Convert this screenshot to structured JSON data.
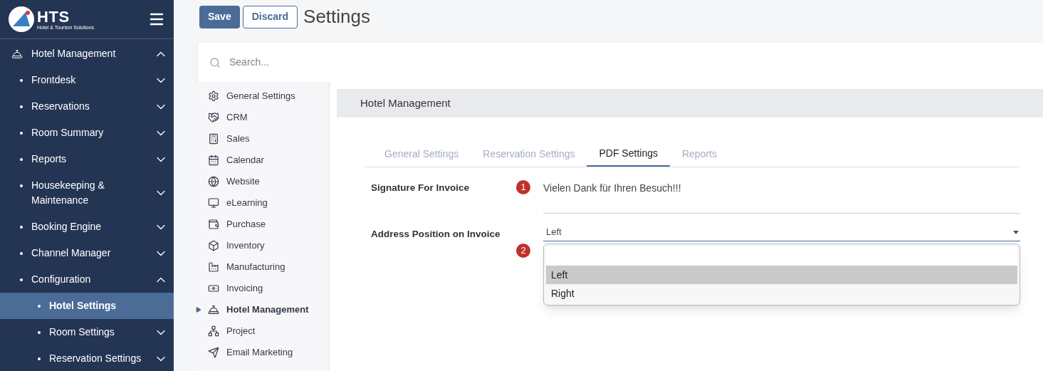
{
  "logo": {
    "name": "HTS",
    "subtitle": "Hotel & Tourism Solutions"
  },
  "sidebar": {
    "items": [
      {
        "label": "Hotel Management",
        "expanded": true,
        "selected": false,
        "children": [
          {
            "label": "Frontdesk",
            "expanded": false,
            "selected": false
          },
          {
            "label": "Reservations",
            "expanded": false,
            "selected": false
          },
          {
            "label": "Room Summary",
            "expanded": false,
            "selected": false
          },
          {
            "label": "Reports",
            "expanded": false,
            "selected": false
          },
          {
            "label": "Housekeeping & Maintenance",
            "expanded": false,
            "selected": false
          },
          {
            "label": "Booking Engine",
            "expanded": false,
            "selected": false
          },
          {
            "label": "Channel Manager",
            "expanded": false,
            "selected": false
          },
          {
            "label": "Configuration",
            "expanded": true,
            "selected": false,
            "children": [
              {
                "label": "Hotel Settings",
                "selected": true
              },
              {
                "label": "Room Settings",
                "expanded": false,
                "selected": false
              },
              {
                "label": "Reservation Settings",
                "expanded": false,
                "selected": false
              }
            ]
          }
        ]
      }
    ]
  },
  "toolbar": {
    "buttons": [
      "Save",
      "Discard"
    ],
    "title": "Settings"
  },
  "search": {
    "placeholder": "Search..."
  },
  "settings_nav": [
    {
      "label": "General Settings",
      "selected": false
    },
    {
      "label": "CRM",
      "selected": false
    },
    {
      "label": "Sales",
      "selected": false
    },
    {
      "label": "Calendar",
      "selected": false
    },
    {
      "label": "Website",
      "selected": false
    },
    {
      "label": "eLearning",
      "selected": false
    },
    {
      "label": "Purchase",
      "selected": false
    },
    {
      "label": "Inventory",
      "selected": false
    },
    {
      "label": "Manufacturing",
      "selected": false
    },
    {
      "label": "Invoicing",
      "selected": false
    },
    {
      "label": "Hotel Management",
      "selected": true
    },
    {
      "label": "Project",
      "selected": false
    },
    {
      "label": "Email Marketing",
      "selected": false
    }
  ],
  "panel": {
    "header": "Hotel Management",
    "tabs": [
      {
        "label": "General Settings",
        "selected": false
      },
      {
        "label": "Reservation Settings",
        "selected": false
      },
      {
        "label": "PDF Settings",
        "selected": true
      },
      {
        "label": "Reports",
        "selected": false
      }
    ],
    "fields": [
      {
        "label": "Signature For Invoice",
        "badge": "1",
        "kind": "text",
        "value": "Vielen Dank für Ihren Besuch!!!"
      },
      {
        "label": "Address Position on Invoice",
        "badge": "2",
        "kind": "select",
        "value": "Left",
        "expanded": true,
        "options": [
          {
            "label": "Left",
            "selected": true
          },
          {
            "label": "Right",
            "selected": false
          }
        ]
      }
    ]
  }
}
